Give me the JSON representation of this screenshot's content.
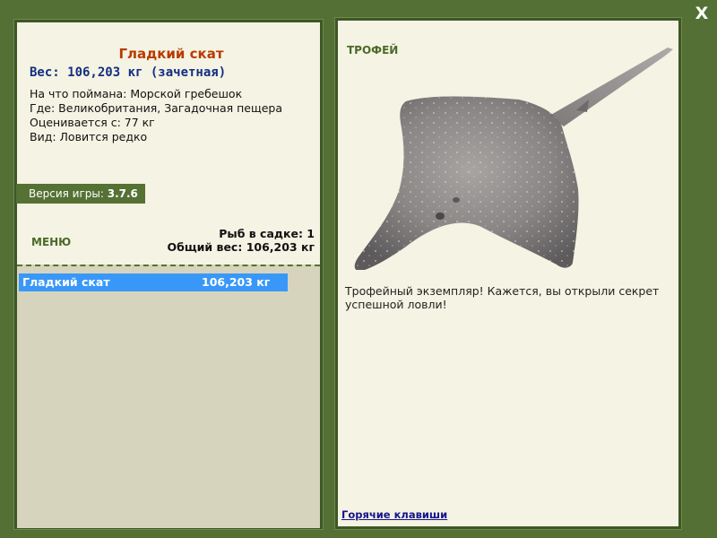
{
  "close_label": "X",
  "left_panel": {
    "fish_name": "Гладкий скат",
    "weight_line": "Вес: 106,203 кг (зачетная)",
    "details": [
      "На что поймана: Морской гребешок",
      "Где: Великобритания, Загадочная пещера",
      "Оценивается с: 77 кг",
      "Вид: Ловится редко"
    ],
    "version_label": "Версия игры:",
    "version_value": "3.7.6",
    "menu_label": "МЕНЮ",
    "fish_count": "Рыб в садке: 1",
    "total_weight": "Общий вес: 106,203 кг",
    "catch_list": [
      {
        "name": "Гладкий скат",
        "weight": "106,203 кг"
      }
    ]
  },
  "right_panel": {
    "trophy_label": "ТРОФЕЙ",
    "trophy_text": "Трофейный экземпляр! Кажется, вы открыли секрет успешной ловли!",
    "hotkeys_label": "Горячие клавиши"
  },
  "colors": {
    "background": "#547035",
    "panel": "#f5f3e3",
    "fish_name": "#b83a00",
    "weight_text": "#142e82",
    "selected_row": "#3998f7",
    "list_area": "#d6d4bc",
    "link": "#15158c"
  }
}
